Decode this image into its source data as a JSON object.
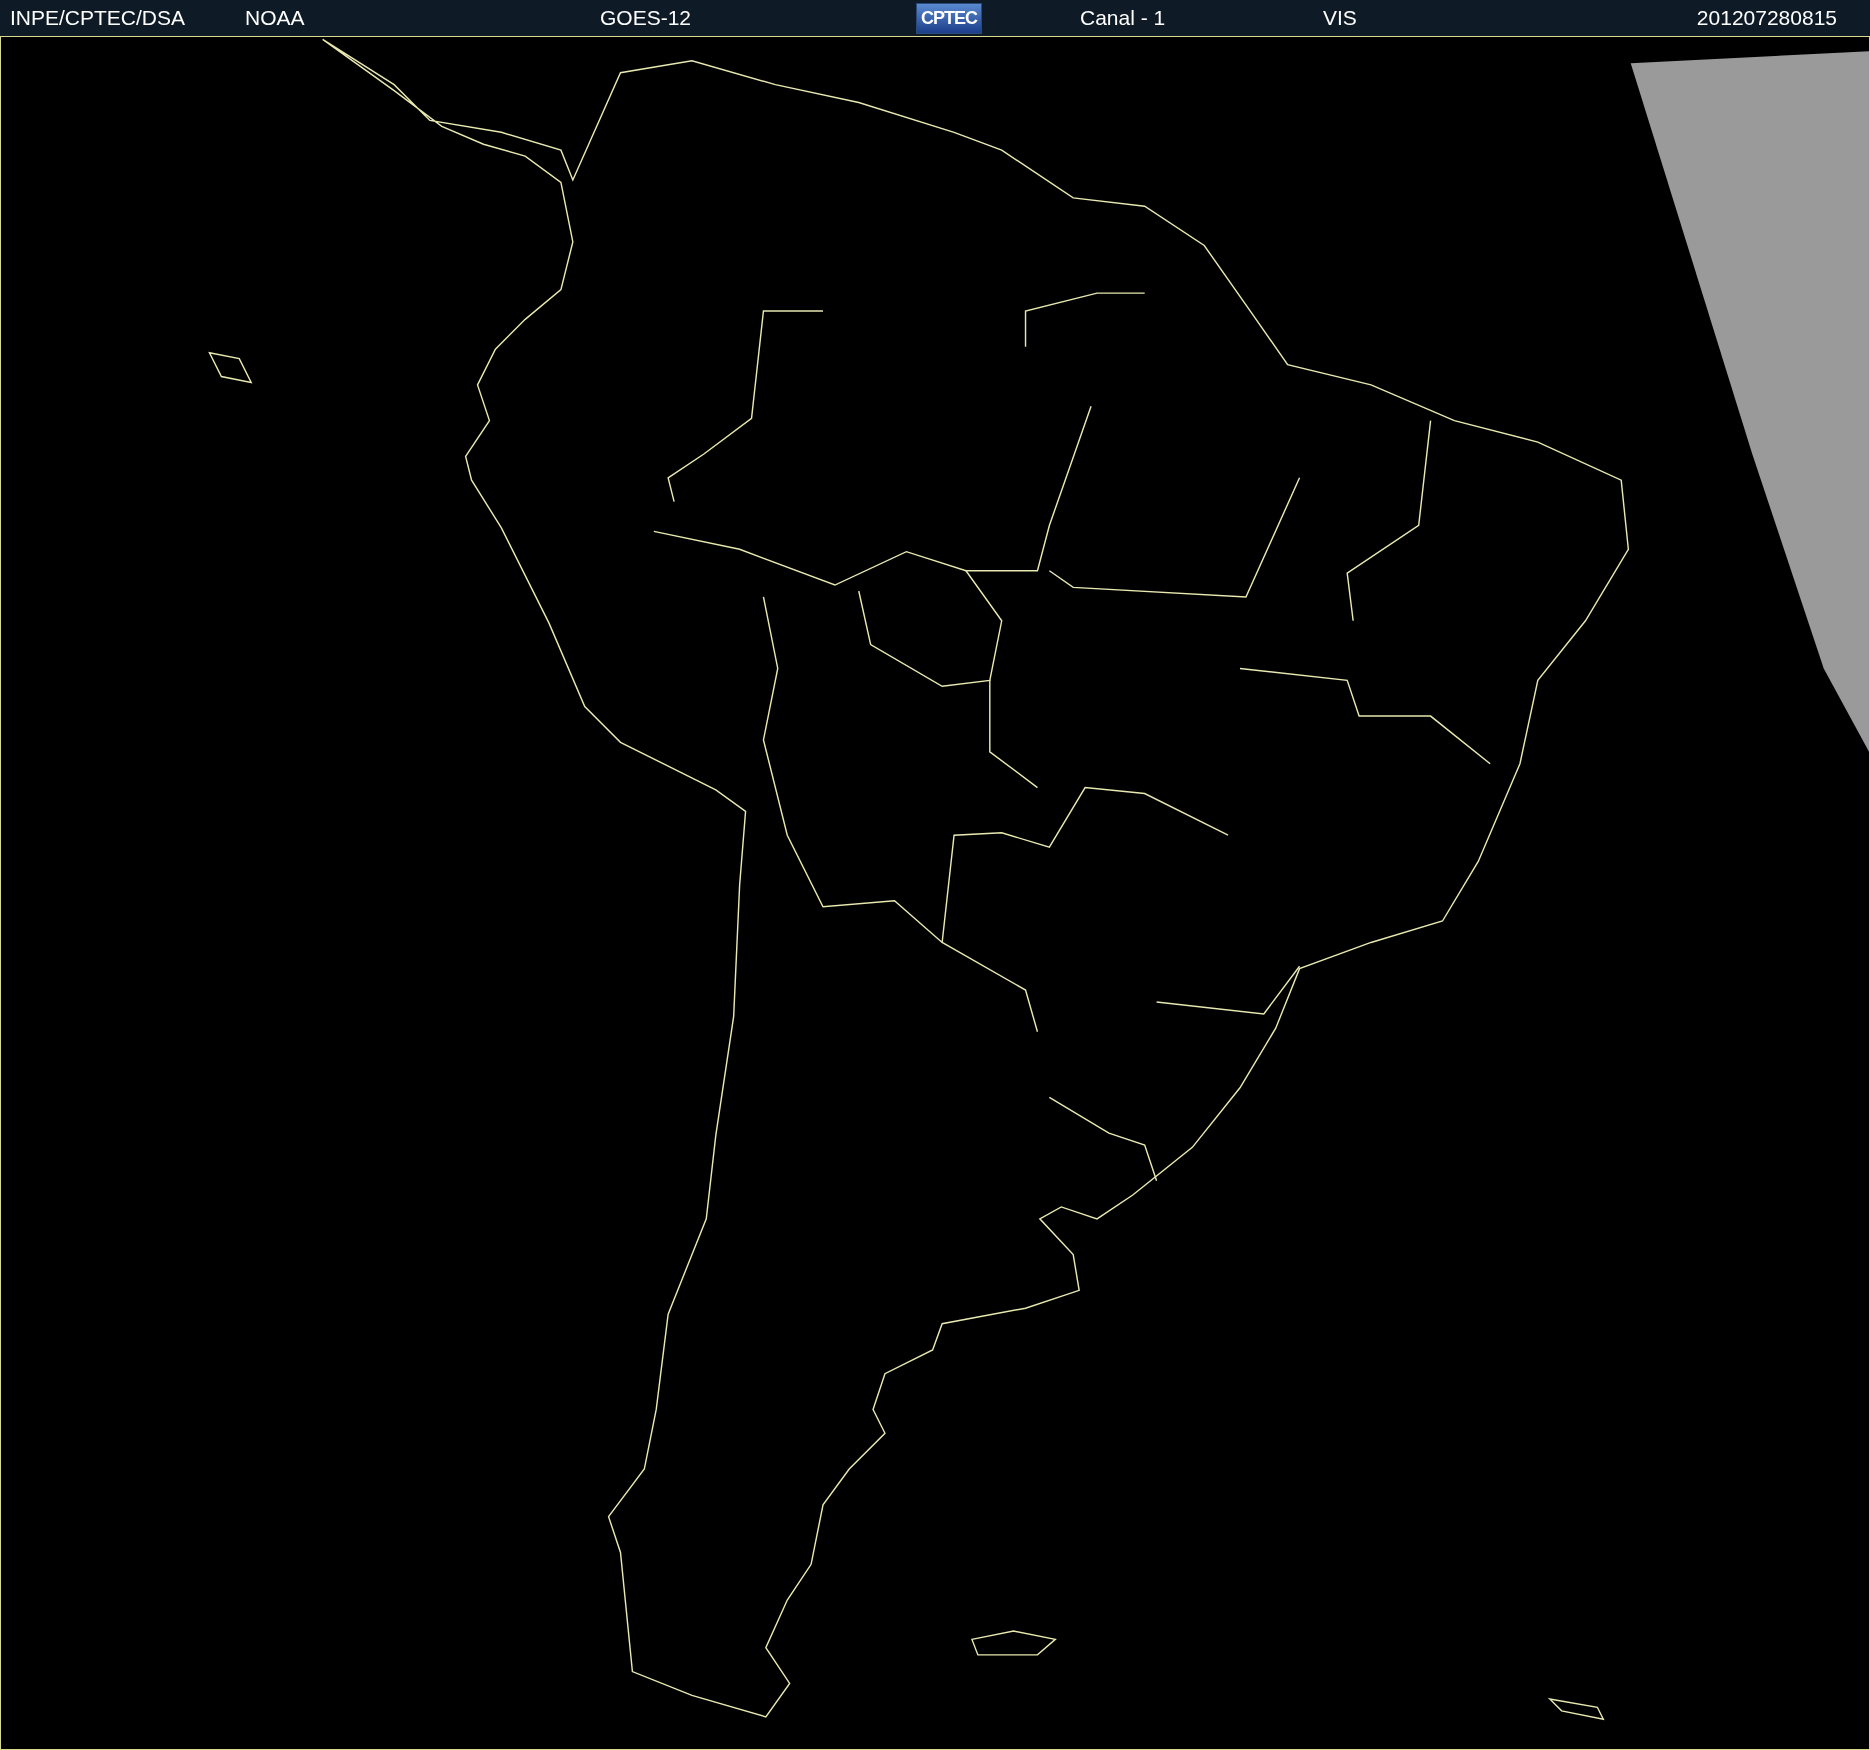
{
  "header": {
    "items": [
      {
        "kind": "text",
        "text": "INPE/CPTEC/DSA"
      },
      {
        "kind": "text",
        "text": "NOAA"
      },
      {
        "kind": "text",
        "text": "GOES-12"
      },
      {
        "kind": "logo",
        "text": "CPTEC"
      },
      {
        "kind": "text",
        "text": "Canal - 1"
      },
      {
        "kind": "text",
        "text": "VIS"
      },
      {
        "kind": "text",
        "text": "201207280815"
      }
    ]
  }
}
